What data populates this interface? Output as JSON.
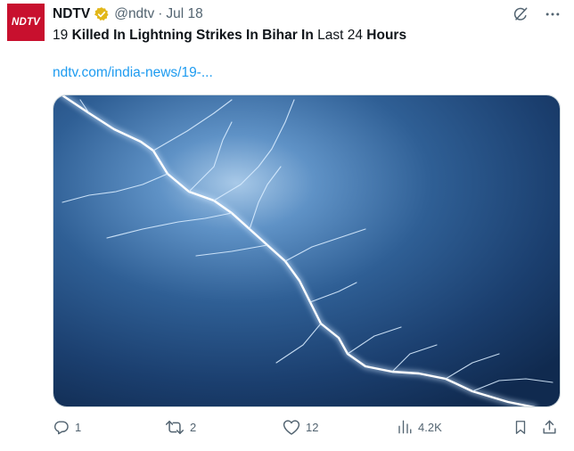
{
  "author": {
    "avatar_text": "NDTV",
    "name": "NDTV",
    "handle": "@ndtv",
    "separator": "·",
    "date": "Jul 18"
  },
  "tweet": {
    "headline_parts": [
      {
        "text": "19 ",
        "bold": false
      },
      {
        "text": "Killed In Lightning Strikes In Bihar In",
        "bold": true
      },
      {
        "text": " Last 24 ",
        "bold": false
      },
      {
        "text": "Hours",
        "bold": true
      }
    ],
    "link": "ndtv.com/india-news/19-..."
  },
  "actions": {
    "replies": "1",
    "retweets": "2",
    "likes": "12",
    "views": "4.2K"
  },
  "icons": {
    "verified": "verified-badge-icon",
    "grok": "grok-icon",
    "more": "more-icon",
    "reply": "reply-icon",
    "retweet": "retweet-icon",
    "like": "like-icon",
    "views": "views-icon",
    "bookmark": "bookmark-icon",
    "share": "share-icon"
  },
  "colors": {
    "brand_red": "#c8102e",
    "link_blue": "#1d9bf0",
    "muted": "#536471",
    "verified_gold": "#e2b719"
  }
}
